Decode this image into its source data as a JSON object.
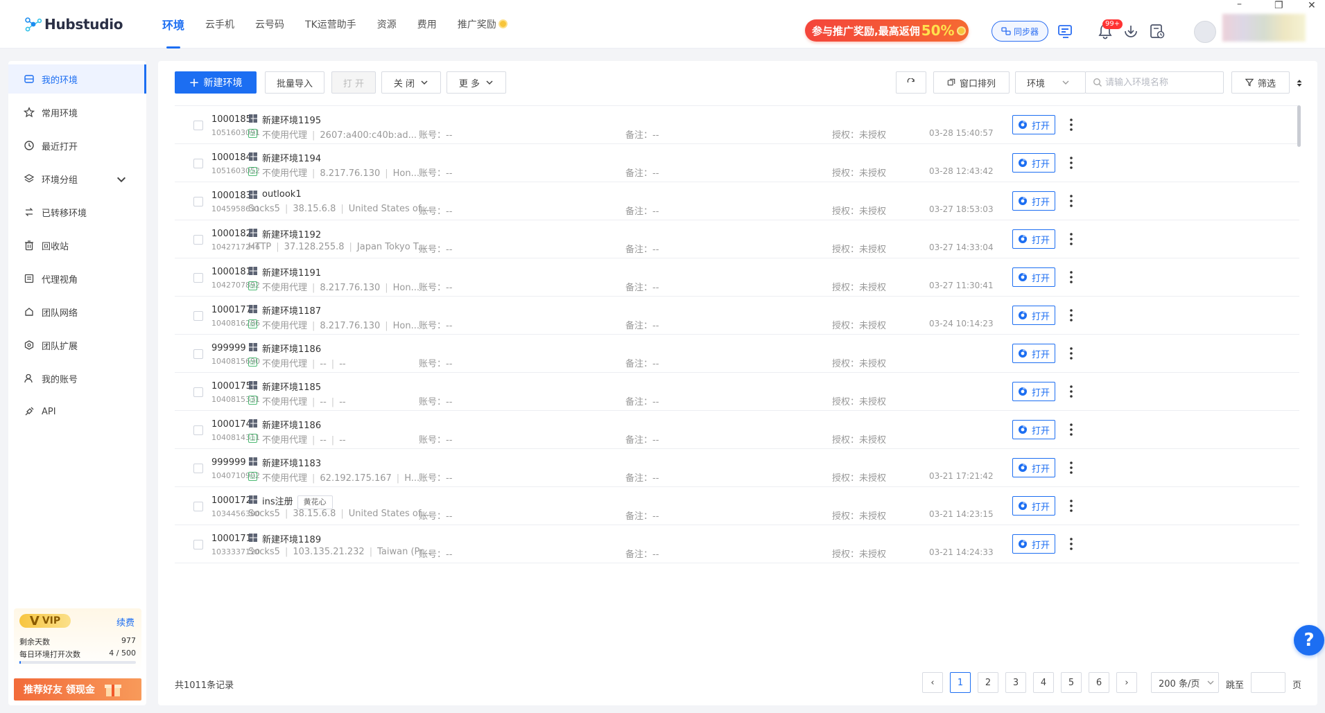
{
  "app": {
    "logo_text": "Hubstudio"
  },
  "nav": {
    "items": [
      {
        "label": "环境",
        "active": true
      },
      {
        "label": "云手机"
      },
      {
        "label": "云号码"
      },
      {
        "label": "TK运营助手"
      },
      {
        "label": "资源"
      },
      {
        "label": "费用"
      },
      {
        "label": "推广奖励"
      }
    ]
  },
  "header": {
    "promo_text": "参与推广奖励,最高返佣",
    "promo_percent": "50%",
    "sync_label": "同步器",
    "notify_badge": "99+",
    "win_controls": [
      "–",
      "❐",
      "✕"
    ]
  },
  "sidebar": {
    "items": [
      {
        "label": "我的环境",
        "icon": "my-env-icon",
        "active": true
      },
      {
        "label": "常用环境",
        "icon": "star-icon"
      },
      {
        "label": "最近打开",
        "icon": "clock-icon"
      },
      {
        "label": "环境分组",
        "icon": "layers-icon",
        "has_chevron": true
      },
      {
        "label": "已转移环境",
        "icon": "transfer-icon"
      },
      {
        "label": "回收站",
        "icon": "trash-icon"
      },
      {
        "label": "代理视角",
        "icon": "proxy-icon"
      },
      {
        "label": "团队网络",
        "icon": "team-network-icon"
      },
      {
        "label": "团队扩展",
        "icon": "extension-icon"
      },
      {
        "label": "我的账号",
        "icon": "user-icon"
      },
      {
        "label": "API",
        "icon": "api-icon"
      }
    ],
    "vip": {
      "tag": "VIP",
      "renew": "续费",
      "days_label": "剩余天数",
      "days_value": "977",
      "opens_label": "每日环境打开次数",
      "opens_value": "4 / 500",
      "opens_fraction": 0.008
    },
    "invite_label": "推荐好友 领现金"
  },
  "toolbar": {
    "new_env": "新建环境",
    "batch_import": "批量导入",
    "open": "打 开",
    "close": "关 闭",
    "more": "更 多",
    "window_arrange": "窗口排列",
    "env_select": "环境",
    "search_placeholder": "请输入环境名称",
    "filter": "筛选"
  },
  "rows": [
    {
      "id": "1000185",
      "sub": "1051603091",
      "name": "新建环境1195",
      "proxy_icon": true,
      "proxy_type": "不使用代理",
      "ip": "2607:a400:c40b:ad...",
      "loc": "",
      "account": "账号：--",
      "note": "备注：--",
      "auth": "授权：未授权",
      "time": "03-28 15:40:57",
      "open": "打开"
    },
    {
      "id": "1000184",
      "sub": "1051603052",
      "name": "新建环境1194",
      "proxy_icon": true,
      "proxy_type": "不使用代理",
      "ip": "8.217.76.130",
      "loc": "Hon...",
      "account": "账号：--",
      "note": "备注：--",
      "auth": "授权：未授权",
      "time": "03-28 12:43:42",
      "open": "打开"
    },
    {
      "id": "1000183",
      "sub": "1045958631",
      "name": "outlook1",
      "proxy_icon": false,
      "proxy_type": "Socks5",
      "ip": "38.15.6.8",
      "loc": "United States of...",
      "account": "账号：--",
      "note": "备注：--",
      "auth": "授权：未授权",
      "time": "03-27 18:53:03",
      "open": "打开"
    },
    {
      "id": "1000182",
      "sub": "1042717246",
      "name": "新建环境1192",
      "proxy_icon": false,
      "proxy_type": "HTTP",
      "ip": "37.128.255.8",
      "loc": "Japan Tokyo T...",
      "account": "账号：--",
      "note": "备注：--",
      "auth": "授权：未授权",
      "time": "03-27 14:33:04",
      "open": "打开"
    },
    {
      "id": "1000181",
      "sub": "1042707892",
      "name": "新建环境1191",
      "proxy_icon": true,
      "proxy_type": "不使用代理",
      "ip": "8.217.76.130",
      "loc": "Hon...",
      "account": "账号：--",
      "note": "备注：--",
      "auth": "授权：未授权",
      "time": "03-27 11:30:41",
      "open": "打开"
    },
    {
      "id": "1000177",
      "sub": "1040816286",
      "name": "新建环境1187",
      "proxy_icon": true,
      "proxy_type": "不使用代理",
      "ip": "8.217.76.130",
      "loc": "Hon...",
      "account": "账号：--",
      "note": "备注：--",
      "auth": "授权：未授权",
      "time": "03-24 10:14:23",
      "open": "打开"
    },
    {
      "id": "999999",
      "sub": "1040815690",
      "name": "新建环境1186",
      "proxy_icon": true,
      "proxy_type": "不使用代理",
      "ip": "--",
      "loc": "--",
      "account": "账号：--",
      "note": "备注：--",
      "auth": "授权：未授权",
      "time": "",
      "open": "打开"
    },
    {
      "id": "1000175",
      "sub": "1040815331",
      "name": "新建环境1185",
      "proxy_icon": true,
      "proxy_type": "不使用代理",
      "ip": "--",
      "loc": "--",
      "account": "账号：--",
      "note": "备注：--",
      "auth": "授权：未授权",
      "time": "",
      "open": "打开"
    },
    {
      "id": "1000174",
      "sub": "1040814311",
      "name": "新建环境1186",
      "proxy_icon": true,
      "proxy_type": "不使用代理",
      "ip": "--",
      "loc": "--",
      "account": "账号：--",
      "note": "备注：--",
      "auth": "授权：未授权",
      "time": "",
      "open": "打开"
    },
    {
      "id": "999999",
      "sub": "1040710902",
      "name": "新建环境1183",
      "proxy_icon": true,
      "proxy_type": "不使用代理",
      "ip": "62.192.175.167",
      "loc": "H...",
      "account": "账号：--",
      "note": "备注：--",
      "auth": "授权：未授权",
      "time": "03-21 17:21:42",
      "open": "打开"
    },
    {
      "id": "1000172",
      "sub": "1034456300",
      "name": "ins注册",
      "tag": "黄花心",
      "proxy_icon": false,
      "proxy_type": "Socks5",
      "ip": "38.15.6.8",
      "loc": "United States of...",
      "account": "账号：--",
      "note": "备注：--",
      "auth": "授权：未授权",
      "time": "03-21 14:23:15",
      "open": "打开"
    },
    {
      "id": "1000171",
      "sub": "1033337120",
      "name": "新建环境1189",
      "proxy_icon": false,
      "proxy_type": "Socks5",
      "ip": "103.135.21.232",
      "loc": "Taiwan (Pr...",
      "account": "账号：--",
      "note": "备注：--",
      "auth": "授权：未授权",
      "time": "03-21 14:24:33",
      "open": "打开"
    }
  ],
  "footer": {
    "total": "共1011条记录",
    "pages": [
      "1",
      "2",
      "3",
      "4",
      "5",
      "6"
    ],
    "active_page": "1",
    "prev": "‹",
    "next": "›",
    "page_size": "200 条/页",
    "jump_label": "跳至",
    "page_unit": "页"
  },
  "help_label": "?",
  "colors": {
    "primary": "#1c6ef2",
    "promo": "#f4453b",
    "vip_gold": "#f7c540"
  }
}
